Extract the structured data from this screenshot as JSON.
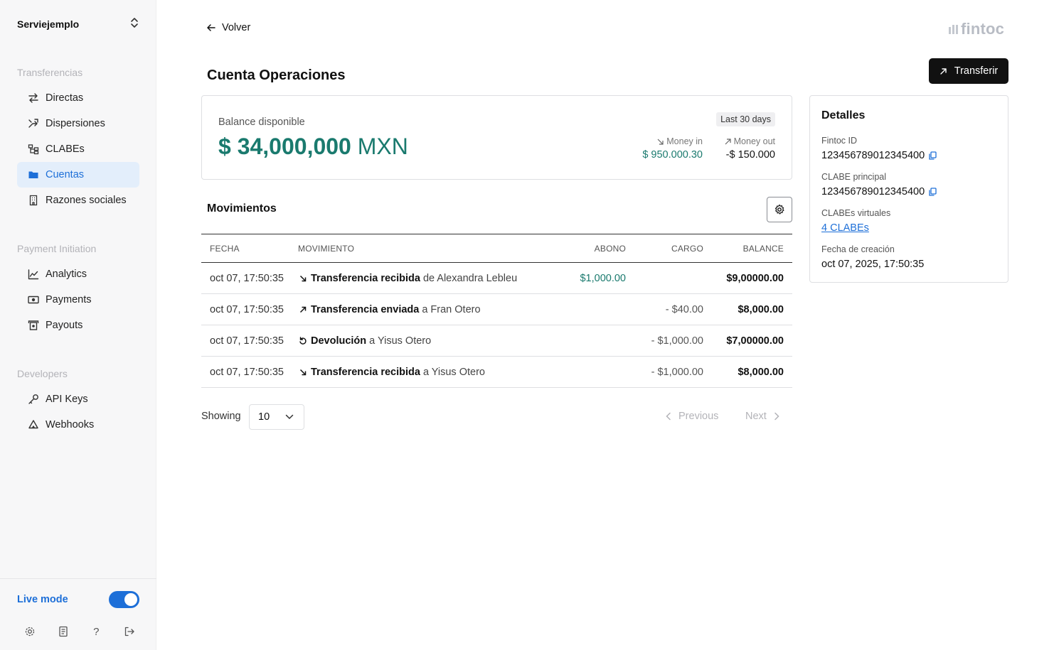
{
  "sidebar": {
    "org_name": "Serviejemplo",
    "sections": [
      {
        "title": "Transferencias",
        "items": [
          {
            "label": "Directas",
            "icon": "arrows-swap-icon"
          },
          {
            "label": "Dispersiones",
            "icon": "split-arrows-icon"
          },
          {
            "label": "CLABEs",
            "icon": "clabes-tree-icon"
          },
          {
            "label": "Cuentas",
            "icon": "folder-icon",
            "active": true
          },
          {
            "label": "Razones sociales",
            "icon": "building-icon"
          }
        ]
      },
      {
        "title": "Payment Initiation",
        "items": [
          {
            "label": "Analytics",
            "icon": "chart-line-icon"
          },
          {
            "label": "Payments",
            "icon": "banknote-icon"
          },
          {
            "label": "Payouts",
            "icon": "payout-icon"
          }
        ]
      },
      {
        "title": "Developers",
        "items": [
          {
            "label": "API Keys",
            "icon": "key-icon"
          },
          {
            "label": "Webhooks",
            "icon": "webhook-icon"
          }
        ]
      }
    ],
    "live_mode_label": "Live mode",
    "live_mode_on": true,
    "bottom_icons": [
      "settings-icon",
      "docs-icon",
      "help-icon",
      "logout-icon"
    ]
  },
  "header": {
    "back_label": "Volver",
    "logo_text": "fintoc",
    "page_title": "Cuenta Operaciones",
    "transfer_label": "Transferir"
  },
  "balance": {
    "label": "Balance disponible",
    "amount": "$ 34,000,000",
    "currency": "MXN",
    "period": "Last 30 days",
    "money_in_label": "Money in",
    "money_in_value": "$ 950.000.30",
    "money_out_label": "Money out",
    "money_out_value": "-$ 150.000"
  },
  "movements": {
    "title": "Movimientos",
    "columns": {
      "fecha": "FECHA",
      "movimiento": "MOVIMIENTO",
      "abono": "ABONO",
      "cargo": "CARGO",
      "balance": "BALANCE"
    },
    "rows": [
      {
        "fecha": "oct 07, 17:50:35",
        "icon": "arrow-down-right-icon",
        "type": "Transferencia recibida",
        "rest": "de Alexandra Lebleu",
        "abono": "$1,000.00",
        "cargo": "",
        "balance": "$9,00000.00"
      },
      {
        "fecha": "oct 07, 17:50:35",
        "icon": "arrow-up-right-icon",
        "type": "Transferencia enviada",
        "rest": "a Fran Otero",
        "abono": "",
        "cargo": "- $40.00",
        "balance": "$8,000.00"
      },
      {
        "fecha": "oct 07, 17:50:35",
        "icon": "undo-icon",
        "type": "Devolución",
        "rest": "a Yisus Otero",
        "abono": "",
        "cargo": "- $1,000.00",
        "balance": "$7,00000.00"
      },
      {
        "fecha": "oct 07, 17:50:35",
        "icon": "arrow-down-right-icon",
        "type": "Transferencia recibida",
        "rest": "a Yisus Otero",
        "abono": "",
        "cargo": "- $1,000.00",
        "balance": "$8,000.00"
      }
    ],
    "showing_label": "Showing",
    "page_size": "10",
    "previous_label": "Previous",
    "next_label": "Next"
  },
  "details": {
    "title": "Detalles",
    "fintoc_id_label": "Fintoc ID",
    "fintoc_id": "123456789012345400",
    "clabe_label": "CLABE principal",
    "clabe": "123456789012345400",
    "virtual_label": "CLABEs virtuales",
    "virtual_link": "4 CLABEs",
    "created_label": "Fecha de creación",
    "created": "oct 07, 2025, 17:50:35"
  },
  "colors": {
    "accent": "#1d6fd8",
    "positive": "#1a7a6e",
    "button_dark": "#111111"
  }
}
